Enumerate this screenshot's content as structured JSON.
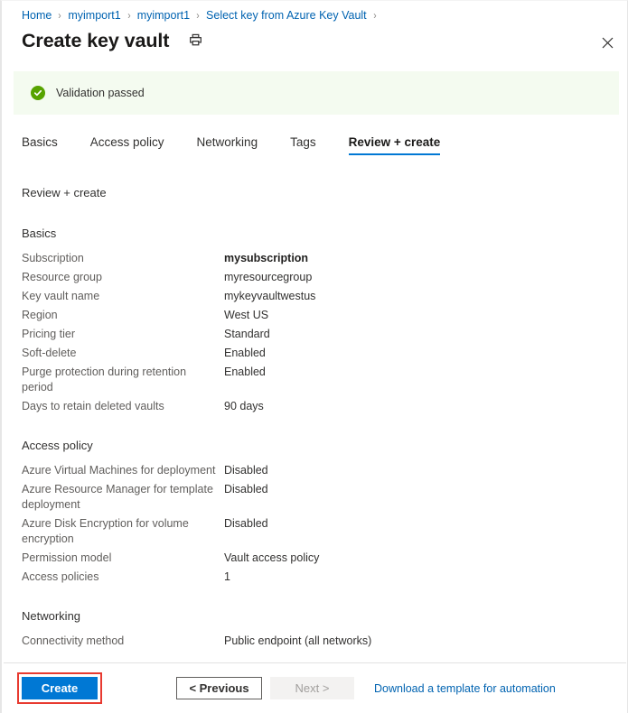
{
  "breadcrumb": {
    "items": [
      "Home",
      "myimport1",
      "myimport1",
      "Select key from Azure Key Vault"
    ],
    "separator": "›"
  },
  "header": {
    "title": "Create key vault",
    "print_icon": "printer-icon",
    "close_icon": "✕"
  },
  "validation": {
    "icon": "check-circle-icon",
    "message": "Validation passed",
    "background": "#f4fbf0",
    "icon_color": "#57a300"
  },
  "tabs": [
    {
      "label": "Basics",
      "active": false
    },
    {
      "label": "Access policy",
      "active": false
    },
    {
      "label": "Networking",
      "active": false
    },
    {
      "label": "Tags",
      "active": false
    },
    {
      "label": "Review + create",
      "active": true
    }
  ],
  "main": {
    "subhead": "Review + create",
    "sections": [
      {
        "title": "Basics",
        "rows": [
          {
            "key": "Subscription",
            "value": "mysubscription",
            "strong": true
          },
          {
            "key": "Resource group",
            "value": "myresourcegroup",
            "strong": false
          },
          {
            "key": "Key vault name",
            "value": "mykeyvaultwestus",
            "strong": false
          },
          {
            "key": "Region",
            "value": "West US",
            "strong": false
          },
          {
            "key": "Pricing tier",
            "value": "Standard",
            "strong": false
          },
          {
            "key": "Soft-delete",
            "value": "Enabled",
            "strong": false
          },
          {
            "key": "Purge protection during retention period",
            "value": "Enabled",
            "strong": false
          },
          {
            "key": "Days to retain deleted vaults",
            "value": "90 days",
            "strong": false
          }
        ]
      },
      {
        "title": "Access policy",
        "rows": [
          {
            "key": "Azure Virtual Machines for deployment",
            "value": "Disabled",
            "strong": false
          },
          {
            "key": "Azure Resource Manager for template deployment",
            "value": "Disabled",
            "strong": false
          },
          {
            "key": "Azure Disk Encryption for volume encryption",
            "value": "Disabled",
            "strong": false
          },
          {
            "key": "Permission model",
            "value": "Vault access policy",
            "strong": false
          },
          {
            "key": "Access policies",
            "value": "1",
            "strong": false
          }
        ]
      },
      {
        "title": "Networking",
        "rows": [
          {
            "key": "Connectivity method",
            "value": "Public endpoint (all networks)",
            "strong": false
          }
        ]
      }
    ]
  },
  "footer": {
    "create_label": "Create",
    "previous_label": "< Previous",
    "next_label": "Next >",
    "download_label": "Download a template for automation",
    "create_color": "#0078d4",
    "highlight_color": "#e83a30",
    "link_color": "#0063b1"
  }
}
